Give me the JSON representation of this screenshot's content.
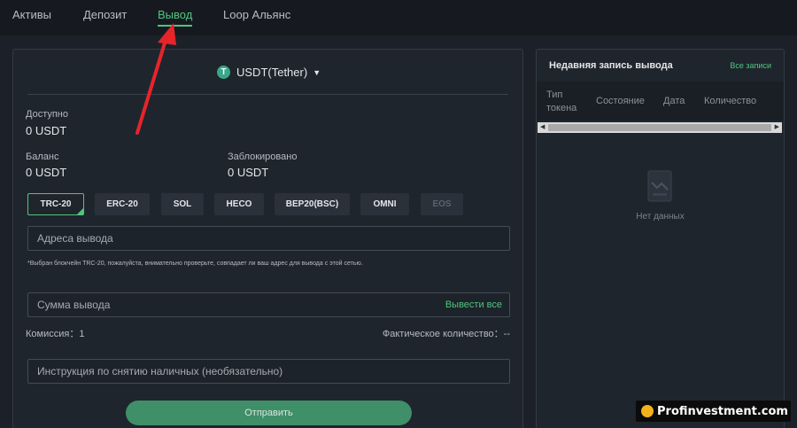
{
  "nav": {
    "tabs": [
      "Активы",
      "Депозит",
      "Вывод",
      "Loop Альянс"
    ],
    "active": "Вывод"
  },
  "token": {
    "name": "USDT(Tether)",
    "icon_glyph": "T",
    "icon": "tether-icon"
  },
  "balances": {
    "available_label": "Доступно",
    "available_value": "0 USDT",
    "balance_label": "Баланс",
    "balance_value": "0 USDT",
    "locked_label": "Заблокировано",
    "locked_value": "0 USDT"
  },
  "chains": [
    {
      "label": "TRC-20",
      "state": "selected"
    },
    {
      "label": "ERC-20",
      "state": "normal"
    },
    {
      "label": "SOL",
      "state": "normal"
    },
    {
      "label": "HECO",
      "state": "normal"
    },
    {
      "label": "BEP20(BSC)",
      "state": "normal"
    },
    {
      "label": "OMNI",
      "state": "normal"
    },
    {
      "label": "EOS",
      "state": "disabled"
    }
  ],
  "form": {
    "address_placeholder": "Адреса вывода",
    "network_note": "*Выбран блокчейн TRC-20, пожалуйста, внимательно проверьте, совпадает ли ваш адрес для вывода с этой сетью.",
    "amount_placeholder": "Сумма вывода",
    "withdraw_all": "Вывести все",
    "fee_label": "Комиссия：1",
    "actual_label": "Фактическое количество：--",
    "instruction_placeholder": "Инструкция по снятию наличных (необязательно)",
    "submit": "Отправить"
  },
  "history": {
    "title": "Недавняя запись вывода",
    "all_records": "Все записи",
    "columns": [
      "Тип токена",
      "Состояние",
      "Дата",
      "Количество"
    ],
    "empty": "Нет данных"
  },
  "watermark": {
    "text": "Profinvestment.com"
  },
  "colors": {
    "accent": "#4fc67e",
    "annotation": "#e8242b"
  }
}
